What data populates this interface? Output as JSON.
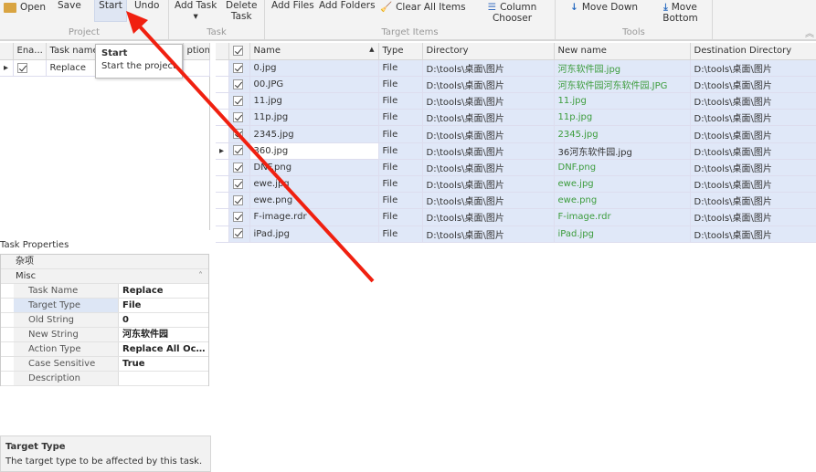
{
  "ribbon": {
    "groups": [
      {
        "label": "Project"
      },
      {
        "label": "Task"
      },
      {
        "label": "Target Items"
      },
      {
        "label": "Tools"
      }
    ],
    "open": "Open",
    "save": "Save",
    "start": "Start",
    "undo": "Undo",
    "add_task": "Add Task",
    "delete_task_1": "Delete",
    "delete_task_2": "Task",
    "add_files": "Add Files",
    "add_folders": "Add Folders",
    "clear_all": "Clear All Items",
    "column_chooser": "Column Chooser",
    "move_down": "Move Down",
    "move_bottom": "Move Bottom"
  },
  "tooltip": {
    "title": "Start",
    "text": "Start the project"
  },
  "task_grid": {
    "headers": [
      "Ena...",
      "Task name",
      "ption"
    ],
    "rows": [
      {
        "name": "Replace",
        "enabled": true
      }
    ]
  },
  "properties": {
    "title": "Task Properties",
    "category_cn": "杂项",
    "category": "Misc",
    "rows": [
      {
        "name": "Task Name",
        "value": "Replace"
      },
      {
        "name": "Target Type",
        "value": "File"
      },
      {
        "name": "Old String",
        "value": "0"
      },
      {
        "name": "New String",
        "value": "河东软件园"
      },
      {
        "name": "Action Type",
        "value": "Replace All Occurr..."
      },
      {
        "name": "Case Sensitive",
        "value": "True"
      },
      {
        "name": "Description",
        "value": ""
      }
    ],
    "desc_title": "Target Type",
    "desc_text": "The target type to be affected by this task."
  },
  "items": {
    "headers": [
      "Name",
      "Type",
      "Directory",
      "New name",
      "Destination Directory"
    ],
    "rows": [
      {
        "name": "0.jpg",
        "type": "File",
        "dir": "D:\\tools\\桌面\\图片",
        "new": "河东软件园.jpg",
        "dest": "D:\\tools\\桌面\\图片"
      },
      {
        "name": "00.JPG",
        "type": "File",
        "dir": "D:\\tools\\桌面\\图片",
        "new": "河东软件园河东软件园.JPG",
        "dest": "D:\\tools\\桌面\\图片"
      },
      {
        "name": "11.jpg",
        "type": "File",
        "dir": "D:\\tools\\桌面\\图片",
        "new": "11.jpg",
        "dest": "D:\\tools\\桌面\\图片"
      },
      {
        "name": "11p.jpg",
        "type": "File",
        "dir": "D:\\tools\\桌面\\图片",
        "new": "11p.jpg",
        "dest": "D:\\tools\\桌面\\图片"
      },
      {
        "name": "2345.jpg",
        "type": "File",
        "dir": "D:\\tools\\桌面\\图片",
        "new": "2345.jpg",
        "dest": "D:\\tools\\桌面\\图片"
      },
      {
        "name": "360.jpg",
        "type": "File",
        "dir": "D:\\tools\\桌面\\图片",
        "new": "36河东软件园.jpg",
        "dest": "D:\\tools\\桌面\\图片",
        "selected": true
      },
      {
        "name": "DNF.png",
        "type": "File",
        "dir": "D:\\tools\\桌面\\图片",
        "new": "DNF.png",
        "dest": "D:\\tools\\桌面\\图片"
      },
      {
        "name": "ewe.jpg",
        "type": "File",
        "dir": "D:\\tools\\桌面\\图片",
        "new": "ewe.jpg",
        "dest": "D:\\tools\\桌面\\图片"
      },
      {
        "name": "ewe.png",
        "type": "File",
        "dir": "D:\\tools\\桌面\\图片",
        "new": "ewe.png",
        "dest": "D:\\tools\\桌面\\图片"
      },
      {
        "name": "F-image.rdr",
        "type": "File",
        "dir": "D:\\tools\\桌面\\图片",
        "new": "F-image.rdr",
        "dest": "D:\\tools\\桌面\\图片"
      },
      {
        "name": "iPad.jpg",
        "type": "File",
        "dir": "D:\\tools\\桌面\\图片",
        "new": "iPad.jpg",
        "dest": "D:\\tools\\桌面\\图片"
      }
    ]
  },
  "colors": {
    "new_name": "#3c9c3c",
    "row_bg": "#e0e8f8",
    "annotation_arrow": "#f02010"
  }
}
